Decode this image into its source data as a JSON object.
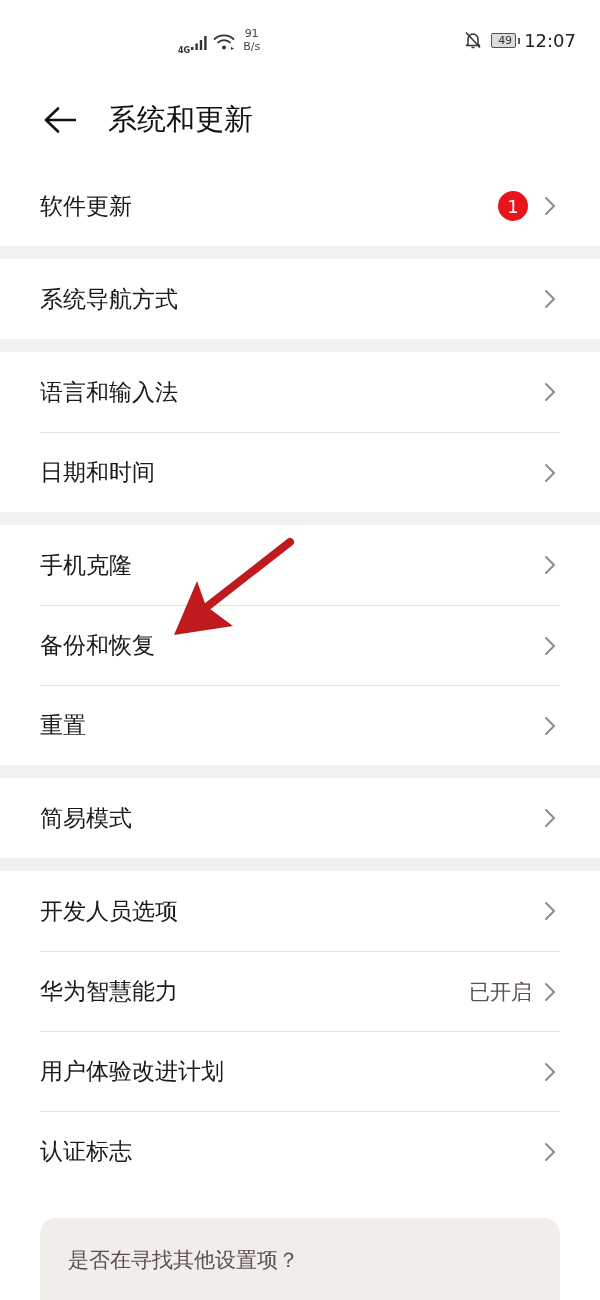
{
  "status_bar": {
    "network": "4G",
    "speed": "91",
    "speed_unit": "B/s",
    "battery": "49",
    "time": "12:07"
  },
  "header": {
    "title": "系统和更新"
  },
  "groups": [
    {
      "items": [
        {
          "label": "软件更新",
          "badge": "1"
        }
      ]
    },
    {
      "items": [
        {
          "label": "系统导航方式"
        }
      ]
    },
    {
      "items": [
        {
          "label": "语言和输入法"
        },
        {
          "label": "日期和时间"
        }
      ]
    },
    {
      "items": [
        {
          "label": "手机克隆"
        },
        {
          "label": "备份和恢复"
        },
        {
          "label": "重置"
        }
      ]
    },
    {
      "items": [
        {
          "label": "简易模式"
        }
      ]
    },
    {
      "items": [
        {
          "label": "开发人员选项"
        },
        {
          "label": "华为智慧能力",
          "value": "已开启"
        },
        {
          "label": "用户体验改进计划"
        },
        {
          "label": "认证标志"
        }
      ]
    }
  ],
  "hint_card": {
    "text": "是否在寻找其他设置项？"
  },
  "annotations": [
    {
      "kind": "arrow"
    }
  ]
}
